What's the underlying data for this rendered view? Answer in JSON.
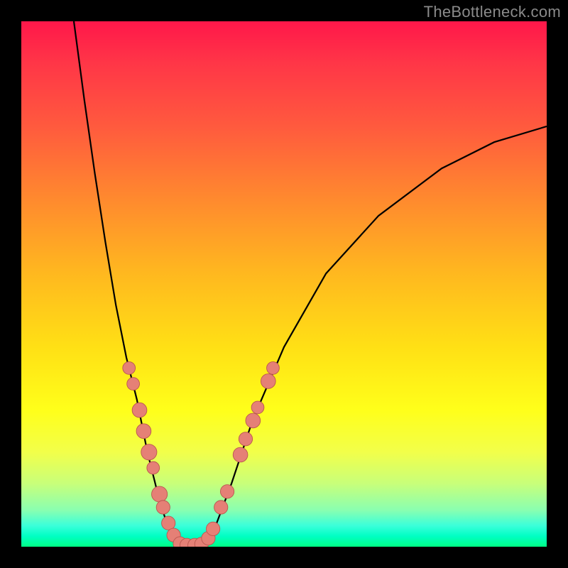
{
  "watermark": "TheBottleneck.com",
  "colors": {
    "frame": "#000000",
    "curve": "#000000",
    "marker_fill": "#e58076",
    "marker_stroke": "#b9564e",
    "gradient_top": "#ff174a",
    "gradient_bottom": "#00ff86"
  },
  "chart_data": {
    "type": "line",
    "title": "",
    "xlabel": "",
    "ylabel": "",
    "xlim": [
      0,
      100
    ],
    "ylim": [
      0,
      100
    ],
    "grid": false,
    "legend": false,
    "description": "Single V-shaped bottleneck curve over a vertical red→green gradient background. Left branch is steep, right branch shallower. Salmon-colored circular markers cluster on the lower portions of both branches and at the trough.",
    "series": [
      {
        "name": "curve_left_branch",
        "x": [
          10,
          12,
          14,
          16,
          18,
          20,
          22,
          24,
          26,
          27.5,
          29,
          30
        ],
        "y": [
          100,
          85,
          71,
          58,
          46,
          36,
          28,
          18,
          10,
          5,
          2,
          0.5
        ]
      },
      {
        "name": "curve_trough",
        "x": [
          30,
          31,
          32,
          33,
          34,
          35
        ],
        "y": [
          0.5,
          0.2,
          0.1,
          0.1,
          0.2,
          0.6
        ]
      },
      {
        "name": "curve_right_branch",
        "x": [
          35,
          37,
          40,
          44,
          50,
          58,
          68,
          80,
          90,
          100
        ],
        "y": [
          0.6,
          4,
          12,
          24,
          38,
          52,
          63,
          72,
          77,
          80
        ]
      }
    ],
    "markers": [
      {
        "branch": "left",
        "x": 20.5,
        "y": 34,
        "r": 1.2
      },
      {
        "branch": "left",
        "x": 21.3,
        "y": 31,
        "r": 1.2
      },
      {
        "branch": "left",
        "x": 22.5,
        "y": 26,
        "r": 1.4
      },
      {
        "branch": "left",
        "x": 23.3,
        "y": 22,
        "r": 1.4
      },
      {
        "branch": "left",
        "x": 24.3,
        "y": 18,
        "r": 1.5
      },
      {
        "branch": "left",
        "x": 25.1,
        "y": 15,
        "r": 1.2
      },
      {
        "branch": "left",
        "x": 26.3,
        "y": 10,
        "r": 1.5
      },
      {
        "branch": "left",
        "x": 27.0,
        "y": 7.5,
        "r": 1.3
      },
      {
        "branch": "left",
        "x": 28.0,
        "y": 4.5,
        "r": 1.3
      },
      {
        "branch": "left",
        "x": 29.0,
        "y": 2.2,
        "r": 1.3
      },
      {
        "branch": "trough",
        "x": 30.2,
        "y": 0.6,
        "r": 1.3
      },
      {
        "branch": "trough",
        "x": 31.5,
        "y": 0.3,
        "r": 1.3
      },
      {
        "branch": "trough",
        "x": 33.0,
        "y": 0.3,
        "r": 1.3
      },
      {
        "branch": "trough",
        "x": 34.3,
        "y": 0.5,
        "r": 1.3
      },
      {
        "branch": "right",
        "x": 35.6,
        "y": 1.6,
        "r": 1.3
      },
      {
        "branch": "right",
        "x": 36.5,
        "y": 3.4,
        "r": 1.3
      },
      {
        "branch": "right",
        "x": 38.0,
        "y": 7.5,
        "r": 1.3
      },
      {
        "branch": "right",
        "x": 39.2,
        "y": 10.5,
        "r": 1.3
      },
      {
        "branch": "right",
        "x": 41.7,
        "y": 17.5,
        "r": 1.4
      },
      {
        "branch": "right",
        "x": 42.7,
        "y": 20.5,
        "r": 1.3
      },
      {
        "branch": "right",
        "x": 44.1,
        "y": 24.0,
        "r": 1.4
      },
      {
        "branch": "right",
        "x": 45.0,
        "y": 26.5,
        "r": 1.2
      },
      {
        "branch": "right",
        "x": 47.0,
        "y": 31.5,
        "r": 1.4
      },
      {
        "branch": "right",
        "x": 47.9,
        "y": 34.0,
        "r": 1.2
      }
    ]
  }
}
